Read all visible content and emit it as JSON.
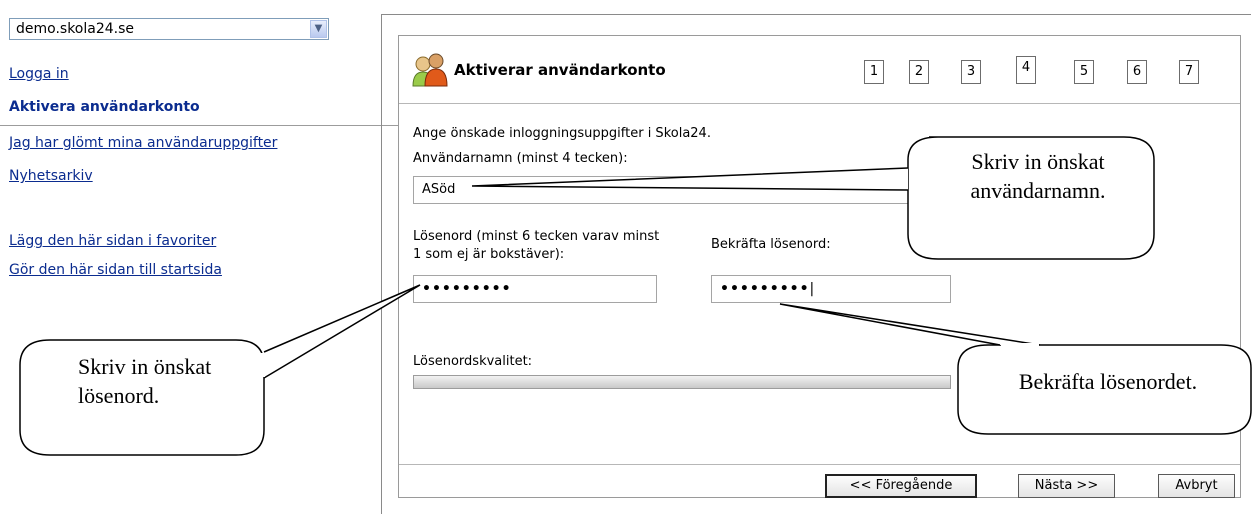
{
  "site_select": {
    "value": "demo.skola24.se"
  },
  "nav": {
    "login": "Logga in",
    "activate": "Aktivera användarkonto",
    "forgot": "Jag har glömt mina användaruppgifter",
    "news": "Nyhetsarkiv",
    "favorites": "Lägg den här sidan i favoriter",
    "startpage": "Gör den här sidan till startsida"
  },
  "dialog": {
    "title": "Aktiverar användarkonto",
    "steps": [
      "1",
      "2",
      "3",
      "4",
      "5",
      "6",
      "7"
    ],
    "current_step": "4",
    "intro": "Ange önskade inloggningsuppgifter i Skola24.",
    "username_label": "Användarnamn (minst 4 tecken):",
    "username_value": "ASöd",
    "password_label_1": "Lösenord (minst 6 tecken varav minst",
    "password_label_2": "1 som ej är bokstäver):",
    "confirm_label": "Bekräfta lösenord:",
    "password_value": "•••••••••",
    "confirm_value": "•••••••••",
    "quality_label": "Lösenordskvalitet:",
    "buttons": {
      "prev": "<< Föregående",
      "next": "Nästa >>",
      "cancel": "Avbryt"
    }
  },
  "callouts": {
    "username_1": "Skriv in önskat",
    "username_2": "användarnamn.",
    "password_1": "Skriv in önskat",
    "password_2": "lösenord.",
    "confirm": "Bekräfta lösenordet."
  },
  "icon": "users-icon"
}
